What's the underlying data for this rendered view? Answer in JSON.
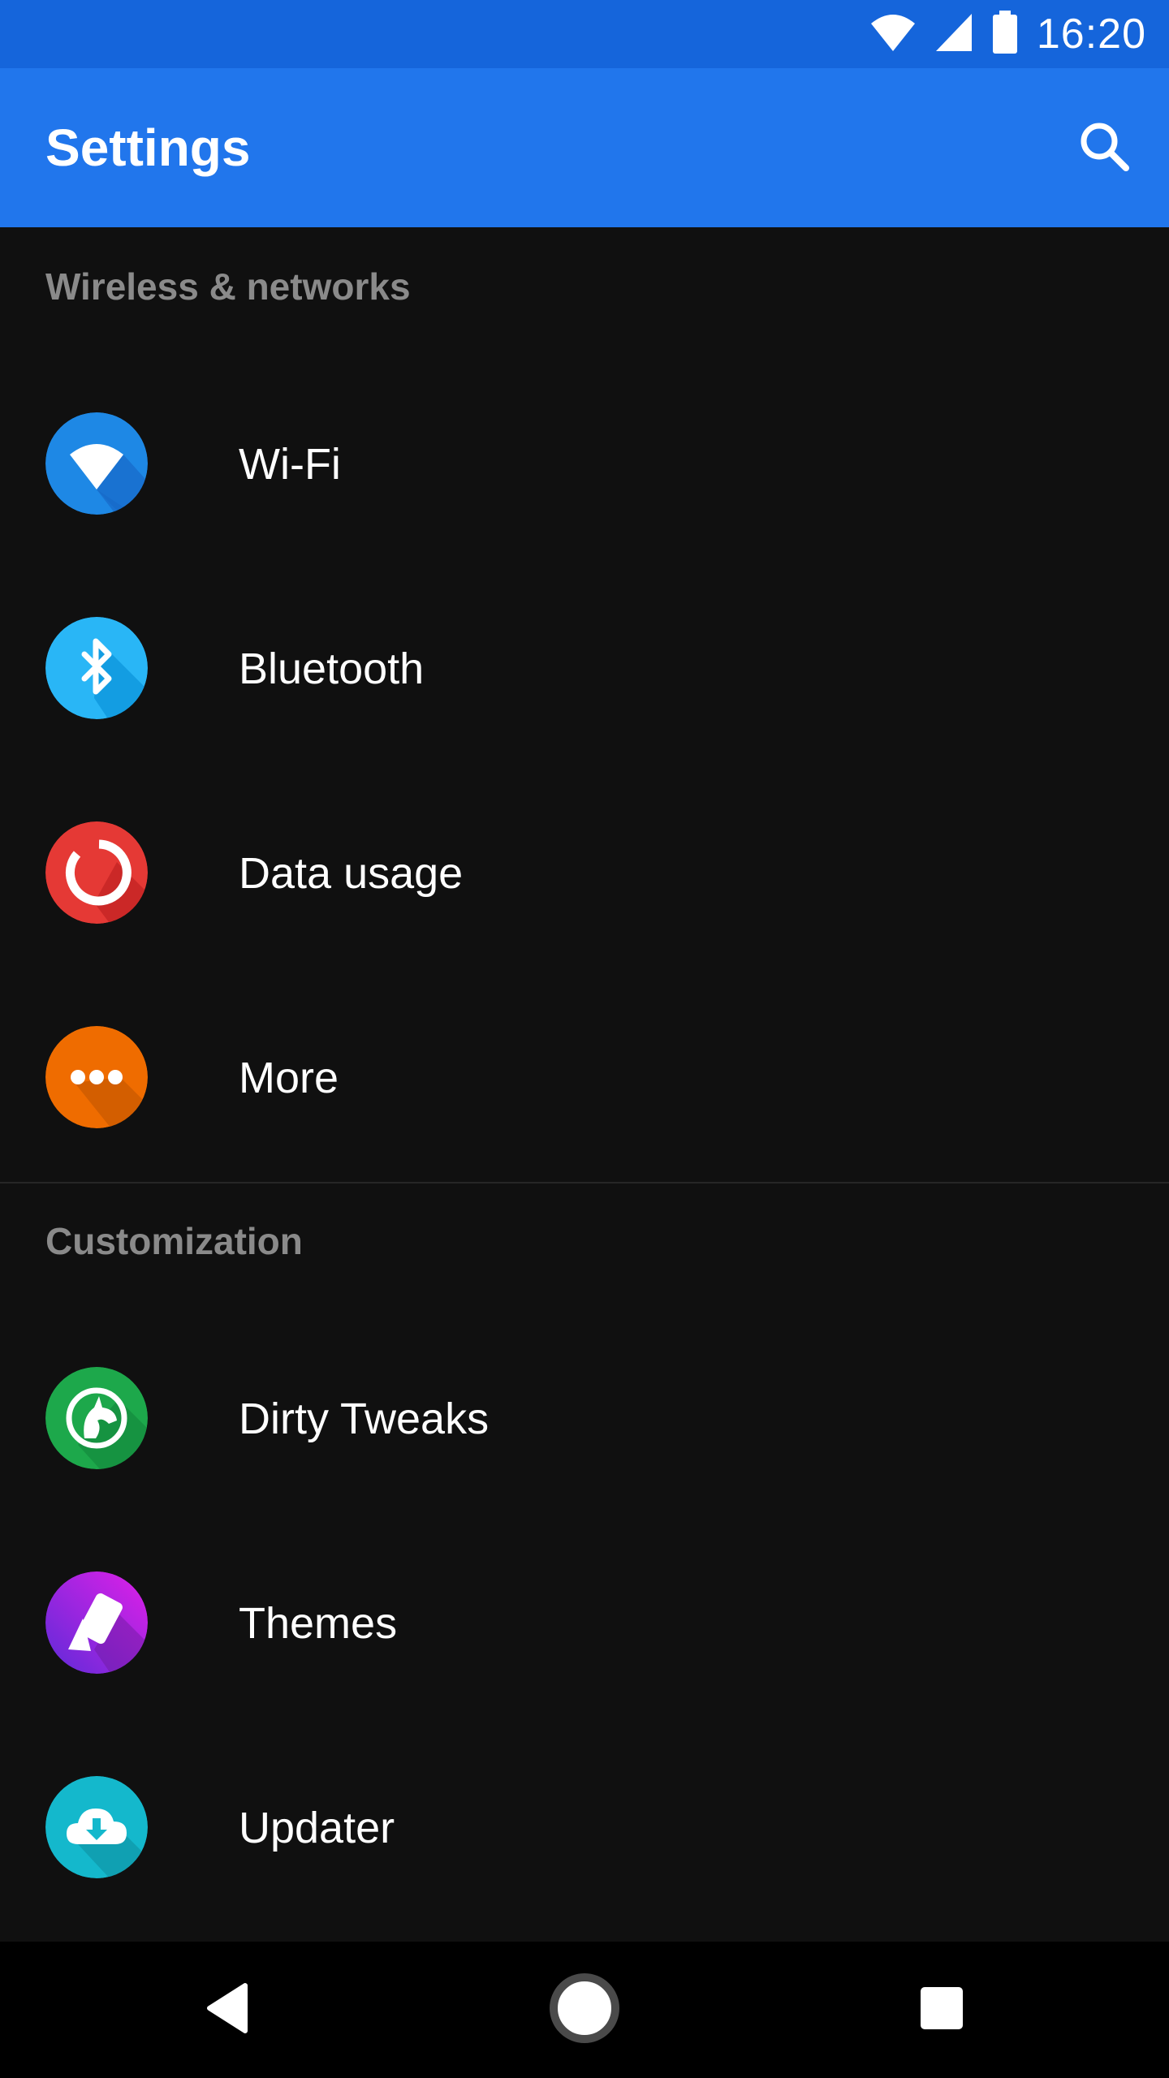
{
  "status_bar": {
    "time": "16:20",
    "icons": [
      "wifi-icon",
      "cell-signal-icon",
      "battery-icon"
    ]
  },
  "app_bar": {
    "title": "Settings",
    "search_icon": "search-icon"
  },
  "sections": [
    {
      "header": "Wireless & networks",
      "items": [
        {
          "label": "Wi-Fi",
          "icon": "wifi-icon",
          "color": "#1E88E5"
        },
        {
          "label": "Bluetooth",
          "icon": "bluetooth-icon",
          "color": "#29B6F6"
        },
        {
          "label": "Data usage",
          "icon": "data-usage-icon",
          "color": "#E53935"
        },
        {
          "label": "More",
          "icon": "more-icon",
          "color": "#EF6C00"
        }
      ]
    },
    {
      "header": "Customization",
      "items": [
        {
          "label": "Dirty Tweaks",
          "icon": "unicorn-icon",
          "color": "#1DA84B"
        },
        {
          "label": "Themes",
          "icon": "themes-icon",
          "color": "#B620E8"
        },
        {
          "label": "Updater",
          "icon": "cloud-download-icon",
          "color": "#14B8CC"
        }
      ]
    }
  ],
  "nav_bar": {
    "icons": [
      "back-icon",
      "home-icon",
      "recents-icon"
    ]
  },
  "colors": {
    "status_bar": "#1565DB",
    "app_bar": "#2176EC",
    "background": "#101010",
    "section_header": "#8A8A8A"
  }
}
